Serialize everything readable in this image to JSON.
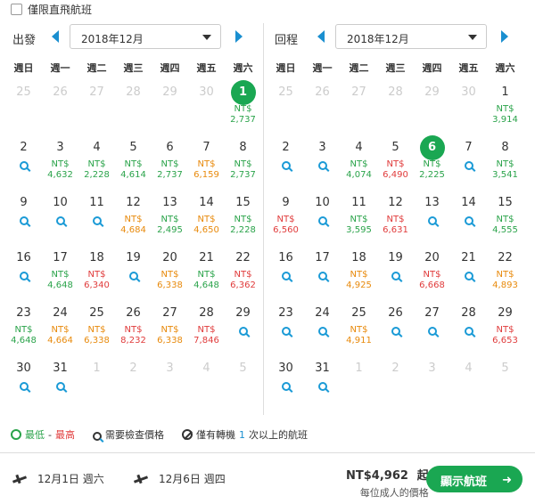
{
  "filter": {
    "label": "僅限直飛航班"
  },
  "weekdays": [
    "週日",
    "週一",
    "週二",
    "週三",
    "週四",
    "週五",
    "週六"
  ],
  "depart": {
    "label": "出發",
    "month": "2018年12月",
    "cells": [
      {
        "d": "25",
        "dim": true
      },
      {
        "d": "26",
        "dim": true
      },
      {
        "d": "27",
        "dim": true
      },
      {
        "d": "28",
        "dim": true
      },
      {
        "d": "29",
        "dim": true
      },
      {
        "d": "30",
        "dim": true
      },
      {
        "d": "1",
        "hl": true,
        "c": "g",
        "p": "2,737"
      },
      {
        "d": "2",
        "s": true
      },
      {
        "d": "3",
        "c": "g",
        "p": "4,632"
      },
      {
        "d": "4",
        "c": "g",
        "p": "2,228"
      },
      {
        "d": "5",
        "c": "g",
        "p": "4,614"
      },
      {
        "d": "6",
        "c": "g",
        "p": "2,737"
      },
      {
        "d": "7",
        "c": "o",
        "p": "6,159"
      },
      {
        "d": "8",
        "c": "g",
        "p": "2,737"
      },
      {
        "d": "9",
        "s": true
      },
      {
        "d": "10",
        "s": true
      },
      {
        "d": "11",
        "s": true
      },
      {
        "d": "12",
        "c": "o",
        "p": "4,684"
      },
      {
        "d": "13",
        "c": "g",
        "p": "2,495"
      },
      {
        "d": "14",
        "c": "o",
        "p": "4,650"
      },
      {
        "d": "15",
        "c": "g",
        "p": "2,228"
      },
      {
        "d": "16",
        "s": true
      },
      {
        "d": "17",
        "c": "g",
        "p": "4,648"
      },
      {
        "d": "18",
        "c": "r",
        "p": "6,340"
      },
      {
        "d": "19",
        "s": true
      },
      {
        "d": "20",
        "c": "o",
        "p": "6,338"
      },
      {
        "d": "21",
        "c": "g",
        "p": "4,648"
      },
      {
        "d": "22",
        "c": "r",
        "p": "6,362"
      },
      {
        "d": "23",
        "c": "g",
        "p": "4,648"
      },
      {
        "d": "24",
        "c": "o",
        "p": "4,664"
      },
      {
        "d": "25",
        "c": "o",
        "p": "6,338"
      },
      {
        "d": "26",
        "c": "r",
        "p": "8,232"
      },
      {
        "d": "27",
        "c": "o",
        "p": "6,338"
      },
      {
        "d": "28",
        "c": "r",
        "p": "7,846"
      },
      {
        "d": "29",
        "s": true
      },
      {
        "d": "30",
        "s": true
      },
      {
        "d": "31",
        "s": true
      },
      {
        "d": "1",
        "dim": true
      },
      {
        "d": "2",
        "dim": true
      },
      {
        "d": "3",
        "dim": true
      },
      {
        "d": "4",
        "dim": true
      },
      {
        "d": "5",
        "dim": true
      }
    ]
  },
  "return": {
    "label": "回程",
    "month": "2018年12月",
    "cells": [
      {
        "d": "25",
        "dim": true
      },
      {
        "d": "26",
        "dim": true
      },
      {
        "d": "27",
        "dim": true
      },
      {
        "d": "28",
        "dim": true
      },
      {
        "d": "29",
        "dim": true
      },
      {
        "d": "30",
        "dim": true
      },
      {
        "d": "1",
        "c": "g",
        "p": "3,914"
      },
      {
        "d": "2",
        "s": true
      },
      {
        "d": "3",
        "s": true
      },
      {
        "d": "4",
        "c": "g",
        "p": "4,074"
      },
      {
        "d": "5",
        "c": "r",
        "p": "6,490"
      },
      {
        "d": "6",
        "hl": true,
        "c": "g",
        "p": "2,225"
      },
      {
        "d": "7",
        "s": true
      },
      {
        "d": "8",
        "c": "g",
        "p": "3,541"
      },
      {
        "d": "9",
        "c": "r",
        "p": "6,560"
      },
      {
        "d": "10",
        "s": true
      },
      {
        "d": "11",
        "c": "g",
        "p": "3,595"
      },
      {
        "d": "12",
        "c": "r",
        "p": "6,631"
      },
      {
        "d": "13",
        "s": true
      },
      {
        "d": "14",
        "s": true
      },
      {
        "d": "15",
        "c": "g",
        "p": "4,555"
      },
      {
        "d": "16",
        "s": true
      },
      {
        "d": "17",
        "s": true
      },
      {
        "d": "18",
        "c": "o",
        "p": "4,925"
      },
      {
        "d": "19",
        "s": true
      },
      {
        "d": "20",
        "c": "r",
        "p": "6,668"
      },
      {
        "d": "21",
        "s": true
      },
      {
        "d": "22",
        "c": "o",
        "p": "4,893"
      },
      {
        "d": "23",
        "s": true
      },
      {
        "d": "24",
        "s": true
      },
      {
        "d": "25",
        "c": "o",
        "p": "4,911"
      },
      {
        "d": "26",
        "s": true
      },
      {
        "d": "27",
        "s": true
      },
      {
        "d": "28",
        "s": true
      },
      {
        "d": "29",
        "c": "r",
        "p": "6,653"
      },
      {
        "d": "30",
        "s": true
      },
      {
        "d": "31",
        "s": true
      },
      {
        "d": "1",
        "dim": true
      },
      {
        "d": "2",
        "dim": true
      },
      {
        "d": "3",
        "dim": true
      },
      {
        "d": "4",
        "dim": true
      },
      {
        "d": "5",
        "dim": true
      }
    ]
  },
  "currency": "NT$",
  "legend": {
    "low": "最低",
    "sep": " - ",
    "high": "最高",
    "check": "需要檢查價格",
    "transfer_pre": "僅有轉機 ",
    "transfer_n": "1",
    "transfer_post": " 次以上的航班"
  },
  "footer": {
    "depart_date": "12月1日 週六",
    "return_date": "12月6日 週四",
    "price": "NT$4,962",
    "from": "起",
    "per": "每位成人的價格",
    "button": "顯示航班",
    "arrow": "➜"
  },
  "colors": {
    "accent": "#1aa752",
    "low": "#2aa34a",
    "mid": "#e88a0c",
    "high": "#e03b3b",
    "nav": "#1a8fd0"
  }
}
